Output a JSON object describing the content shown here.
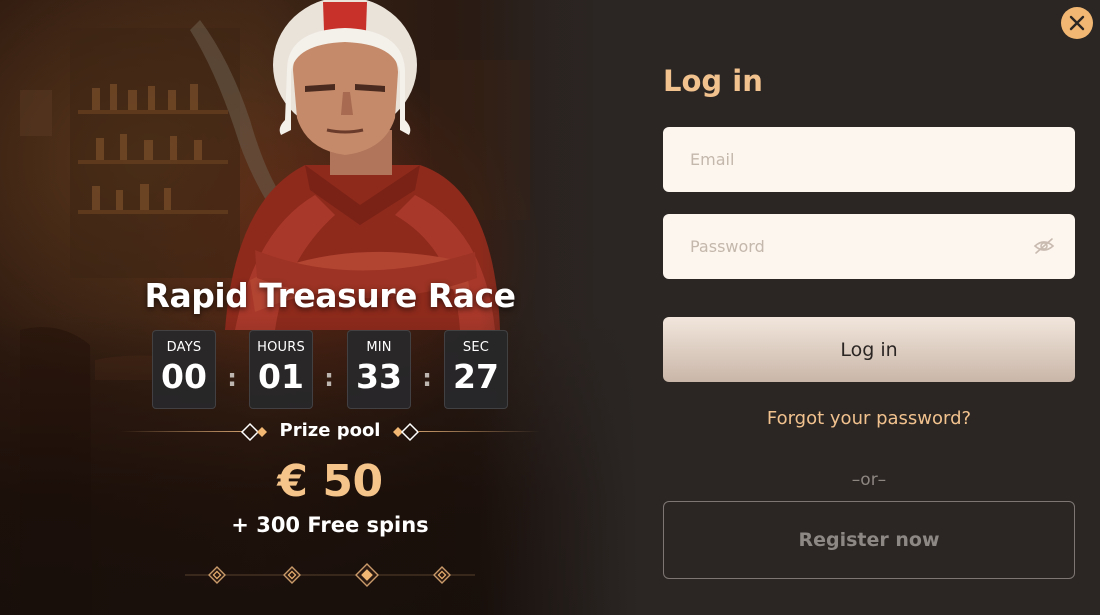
{
  "promo": {
    "title": "Rapid Treasure Race",
    "countdown": [
      {
        "label": "DAYS",
        "value": "00"
      },
      {
        "label": "HOURS",
        "value": "01"
      },
      {
        "label": "MIN",
        "value": "33"
      },
      {
        "label": "SEC",
        "value": "27"
      }
    ],
    "separator": ":",
    "prize_label": "Prize pool",
    "prize_amount": "€ 50",
    "prize_extra": "+ 300 Free spins",
    "pager": {
      "count": 4,
      "active_index": 2
    }
  },
  "login": {
    "title": "Log in",
    "email_placeholder": "Email",
    "password_placeholder": "Password",
    "submit_label": "Log in",
    "forgot_label": "Forgot your password?",
    "or_label": "–or–",
    "register_label": "Register now"
  },
  "icons": {
    "close": "close-icon",
    "password_toggle": "eye-off-icon",
    "pager_marker": "diamond-icon"
  },
  "colors": {
    "accent": "#f2c28e",
    "close_bg": "#f2b772",
    "panel_bg": "#2b2624",
    "field_bg": "#fdf6ef",
    "prize_amount": "#f5c48a"
  }
}
